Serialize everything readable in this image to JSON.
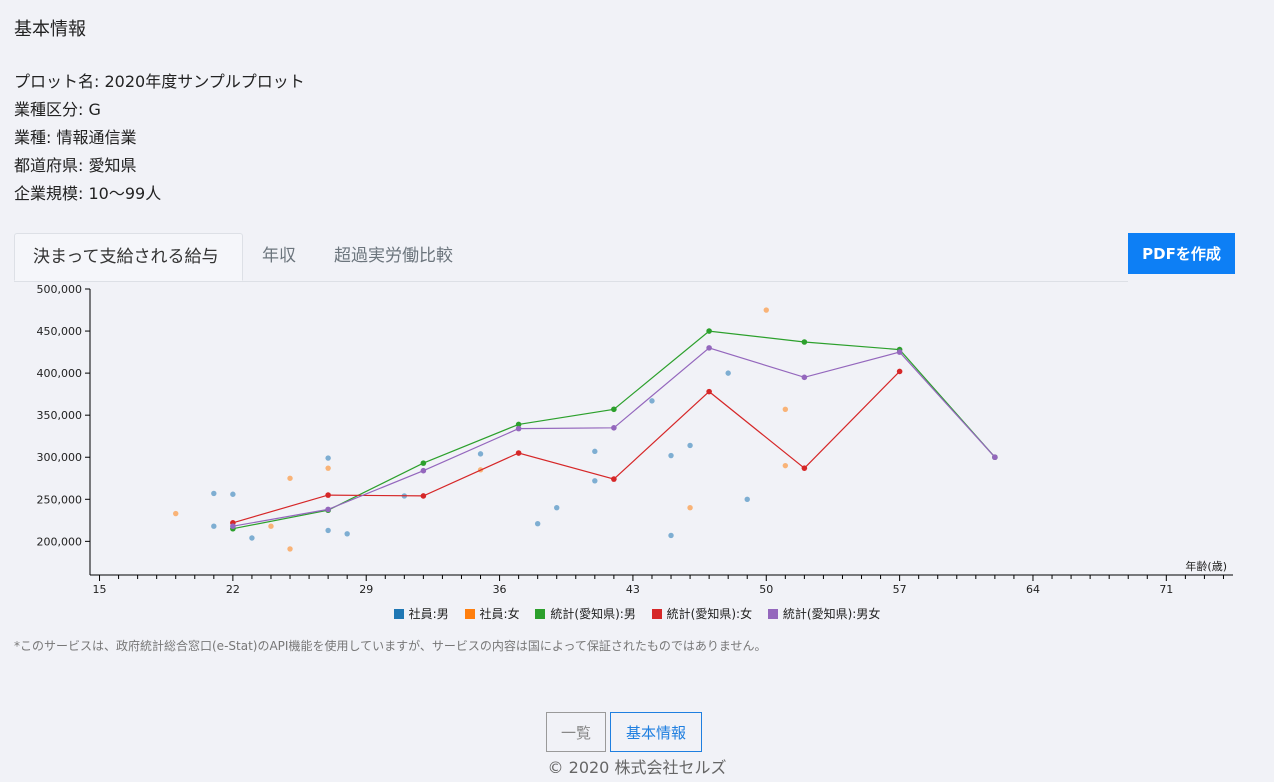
{
  "page": {
    "section_title": "基本情報",
    "info": [
      "プロット名: 2020年度サンプルプロット",
      "業種区分: G",
      "業種: 情報通信業",
      "都道府県: 愛知県",
      "企業規模: 10〜99人"
    ],
    "tabs": [
      "決まって支給される給与",
      "年収",
      "超過実労働比較"
    ],
    "pdf_button": "PDFを作成",
    "note": "*このサービスは、政府統計総合窓口(e-Stat)のAPI機能を使用していますが、サービスの内容は国によって保証されたものではありません。",
    "nav": {
      "list": "一覧",
      "info": "基本情報"
    },
    "footer": "© 2020 株式会社セルズ"
  },
  "chart_data": {
    "type": "scatter",
    "title": "",
    "xlabel": "年齢(歳)",
    "ylabel": "",
    "xlim": [
      14.5,
      74.5
    ],
    "ylim": [
      160000,
      500000
    ],
    "x_ticks": [
      15,
      22,
      29,
      36,
      43,
      50,
      57,
      64,
      71
    ],
    "y_ticks": [
      200000,
      250000,
      300000,
      350000,
      400000,
      450000,
      500000
    ],
    "y_tick_labels": [
      "200,000",
      "250,000",
      "300,000",
      "350,000",
      "400,000",
      "450,000",
      "500,000"
    ],
    "legend_position": "bottom",
    "series": [
      {
        "name": "社員:男",
        "kind": "points",
        "color": "#1f77b4",
        "points": [
          [
            21,
            257000
          ],
          [
            21,
            218000
          ],
          [
            22,
            256000
          ],
          [
            23,
            204000
          ],
          [
            27,
            299000
          ],
          [
            27,
            213000
          ],
          [
            28,
            209000
          ],
          [
            31,
            254000
          ],
          [
            35,
            304000
          ],
          [
            38,
            221000
          ],
          [
            39,
            240000
          ],
          [
            41,
            307000
          ],
          [
            41,
            272000
          ],
          [
            44,
            367000
          ],
          [
            45,
            302000
          ],
          [
            45,
            207000
          ],
          [
            46,
            314000
          ],
          [
            48,
            400000
          ],
          [
            49,
            250000
          ]
        ]
      },
      {
        "name": "社員:女",
        "kind": "points",
        "color": "#ff7f0e",
        "points": [
          [
            19,
            233000
          ],
          [
            24,
            218000
          ],
          [
            25,
            275000
          ],
          [
            25,
            191000
          ],
          [
            27,
            287000
          ],
          [
            35,
            285000
          ],
          [
            46,
            240000
          ],
          [
            50,
            475000
          ],
          [
            51,
            357000
          ],
          [
            51,
            290000
          ]
        ]
      },
      {
        "name": "統計(愛知県):男",
        "kind": "line",
        "color": "#2ca02c",
        "points": [
          [
            22,
            215000
          ],
          [
            27,
            237000
          ],
          [
            32,
            293000
          ],
          [
            37,
            339000
          ],
          [
            42,
            357000
          ],
          [
            47,
            450000
          ],
          [
            52,
            437000
          ],
          [
            57,
            428000
          ],
          [
            62,
            300000
          ]
        ]
      },
      {
        "name": "統計(愛知県):女",
        "kind": "line",
        "color": "#d62728",
        "points": [
          [
            22,
            222000
          ],
          [
            27,
            255000
          ],
          [
            32,
            254000
          ],
          [
            37,
            305000
          ],
          [
            42,
            274000
          ],
          [
            47,
            378000
          ],
          [
            52,
            287000
          ],
          [
            57,
            402000
          ]
        ]
      },
      {
        "name": "統計(愛知県):男女",
        "kind": "line",
        "color": "#9467bd",
        "points": [
          [
            22,
            218000
          ],
          [
            27,
            238000
          ],
          [
            32,
            284000
          ],
          [
            37,
            334000
          ],
          [
            42,
            335000
          ],
          [
            47,
            430000
          ],
          [
            52,
            395000
          ],
          [
            57,
            425000
          ],
          [
            62,
            300000
          ]
        ]
      }
    ]
  }
}
